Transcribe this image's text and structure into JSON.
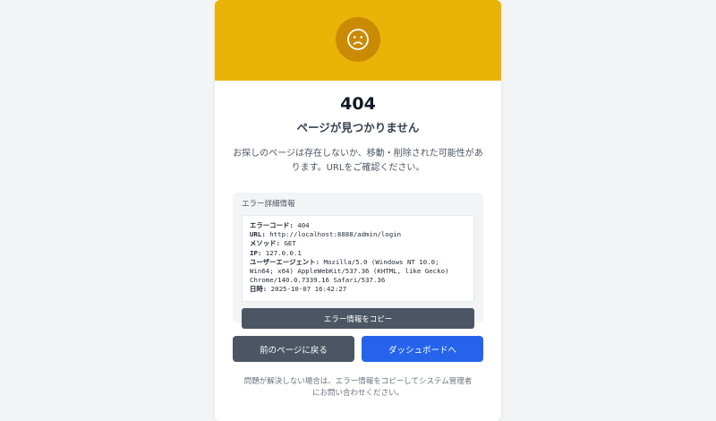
{
  "header": {
    "icon": "sad-face-icon",
    "color": "#eab308",
    "icon_bg": "#ca8a04"
  },
  "error": {
    "code": "404",
    "title": "ページが見つかりません",
    "message": "お探しのページは存在しないか、移動・削除された可能性があります。URLをご確認ください。"
  },
  "details": {
    "heading": "エラー詳細情報",
    "rows": [
      {
        "label": "エラーコード:",
        "value": " 404"
      },
      {
        "label": "URL:",
        "value": " http://localhost:8888/admin/login"
      },
      {
        "label": "メソッド:",
        "value": " GET"
      },
      {
        "label": "IP:",
        "value": " 127.0.0.1"
      },
      {
        "label": "ユーザーエージェント:",
        "value": " Mozilla/5.0 (Windows NT 10.0; Win64; x64) AppleWebKit/537.36 (KHTML, like Gecko) Chrome/140.0.7339.16 Safari/537.36"
      },
      {
        "label": "日時:",
        "value": " 2025-10-07 16:42:27"
      }
    ],
    "copy_label": "エラー情報をコピー"
  },
  "actions": {
    "back_label": "前のページに戻る",
    "dashboard_label": "ダッシュボードへ"
  },
  "footer": {
    "text": "問題が解決しない場合は、エラー情報をコピーしてシステム管理者にお問い合わせください。"
  },
  "colors": {
    "primary": "#2563eb",
    "secondary": "#4b5563",
    "warning": "#eab308"
  }
}
